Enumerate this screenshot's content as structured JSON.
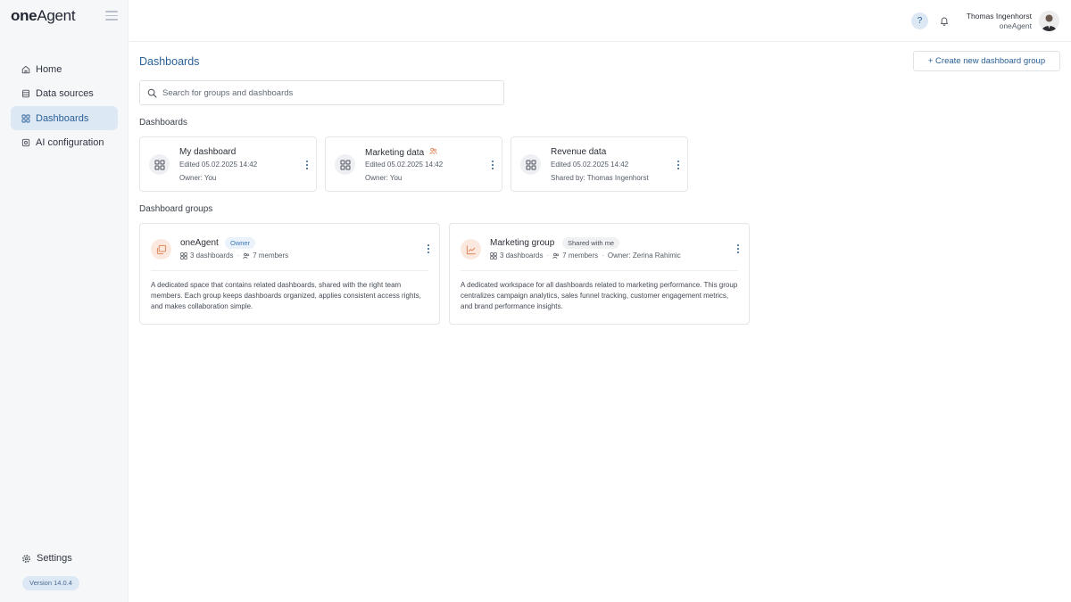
{
  "app": {
    "logo_bold": "one",
    "logo_thin": "Agent"
  },
  "sidebar": {
    "items": [
      {
        "label": "Home",
        "icon": "home-icon"
      },
      {
        "label": "Data sources",
        "icon": "database-icon"
      },
      {
        "label": "Dashboards",
        "icon": "grid-icon",
        "active": true
      },
      {
        "label": "AI configuration",
        "icon": "ai-chip-icon"
      }
    ],
    "settings_label": "Settings",
    "version": "Version 14.0.4"
  },
  "topbar": {
    "help_label": "?",
    "user_name": "Thomas Ingenhorst",
    "user_org": "oneAgent"
  },
  "main": {
    "title": "Dashboards",
    "create_button": "+ Create new dashboard group",
    "search_placeholder": "Search for groups and dashboards",
    "dashboards_section": "Dashboards",
    "dashboards": [
      {
        "name": "My dashboard",
        "edited": "Edited 05.02.2025 14:42",
        "owner": "Owner: You"
      },
      {
        "name": "Marketing data",
        "edited": "Edited 05.02.2025 14:42",
        "owner": "Owner: You",
        "shared_indicator": "users-icon"
      },
      {
        "name": "Revenue data",
        "edited": "Edited 05.02.2025 14:42",
        "owner": "Shared by: Thomas Ingenhorst"
      }
    ],
    "groups_section": "Dashboard groups",
    "groups": [
      {
        "name": "oneAgent",
        "badge": "Owner",
        "dashboards": "3 dashboards",
        "members": "7 members",
        "owner": "",
        "description": "A dedicated space that contains related dashboards, shared with the right team members. Each group keeps dashboards organized, applies consistent access rights, and makes collaboration simple."
      },
      {
        "name": "Marketing group",
        "badge": "Shared with me",
        "dashboards": "3 dashboards",
        "members": "7 members",
        "owner": "Owner: Zerina Rahimic",
        "description": "A dedicated workspace for all dashboards related to marketing performance. This group centralizes campaign analytics, sales funnel tracking, customer engagement metrics, and brand performance insights."
      }
    ]
  },
  "colors": {
    "accent": "#2a5f96",
    "active_bg": "#dde8f5",
    "group_icon_bg": "#fbe9df",
    "group_icon_fg": "#e0865a"
  }
}
